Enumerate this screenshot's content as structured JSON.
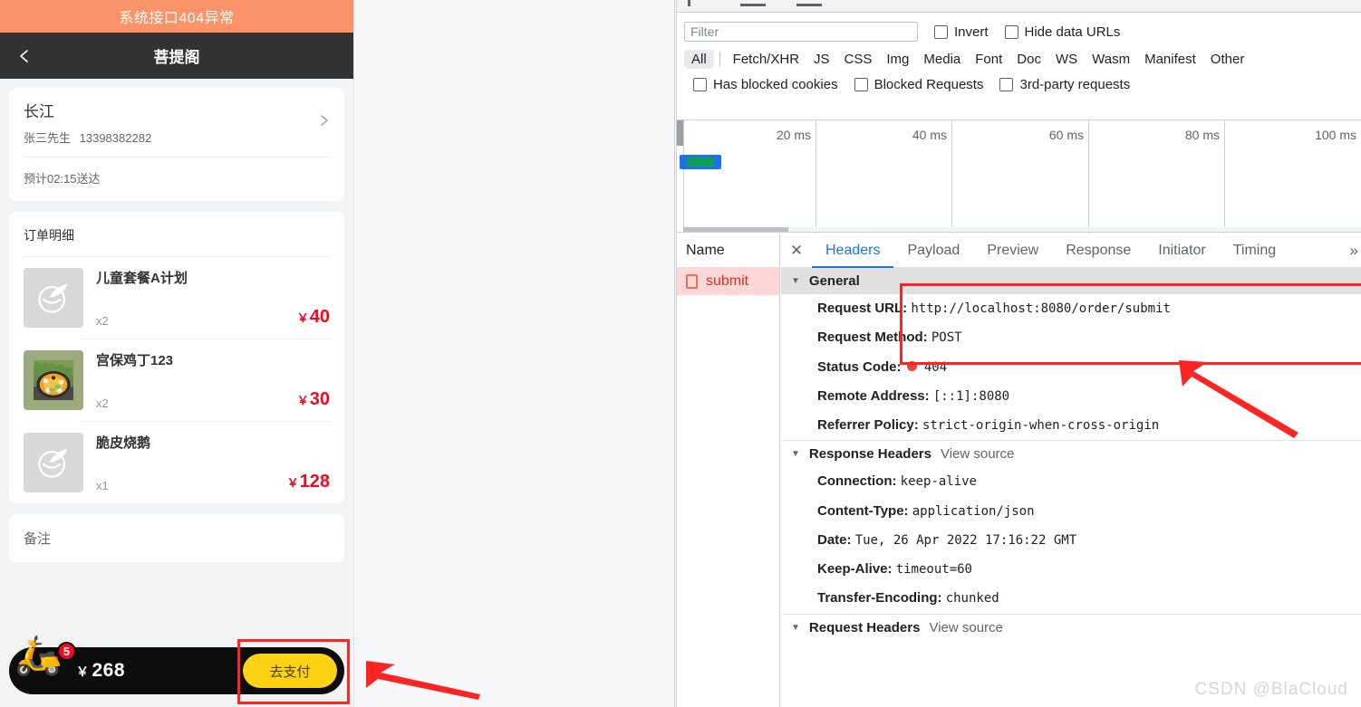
{
  "mobile": {
    "alert_banner": "系统接口404异常",
    "nav": {
      "back_icon": "chevron-left-icon",
      "title": "菩提阁"
    },
    "address": {
      "name": "长江",
      "contact": "张三先生",
      "phone": "13398382282",
      "chevron_icon": "chevron-right-icon",
      "eta": "预计02:15送达"
    },
    "order": {
      "title": "订单明细",
      "items": [
        {
          "name": "儿童套餐A计划",
          "qty": "x2",
          "currency": "￥",
          "price": "40",
          "thumb": "placeholder-bowl-icon"
        },
        {
          "name": "宫保鸡丁123",
          "qty": "x2",
          "currency": "￥",
          "price": "30",
          "thumb": "food-photo"
        },
        {
          "name": "脆皮烧鹅",
          "qty": "x1",
          "currency": "￥",
          "price": "128",
          "thumb": "placeholder-bowl-icon"
        }
      ]
    },
    "remark": {
      "label": "备注"
    },
    "submit_bar": {
      "rider_icon": "delivery-rider-icon",
      "cart_badge": "5",
      "currency": "￥",
      "total": "268",
      "pay_label": "去支付"
    }
  },
  "devtools": {
    "filter": {
      "placeholder": "Filter",
      "value": "",
      "invert_label": "Invert",
      "hide_data_urls_label": "Hide data URLs"
    },
    "type_filters": [
      "All",
      "Fetch/XHR",
      "JS",
      "CSS",
      "Img",
      "Media",
      "Font",
      "Doc",
      "WS",
      "Wasm",
      "Manifest",
      "Other"
    ],
    "type_active": "All",
    "blocked_filters": [
      "Has blocked cookies",
      "Blocked Requests",
      "3rd-party requests"
    ],
    "overview": {
      "ticks": [
        "20 ms",
        "40 ms",
        "60 ms",
        "80 ms",
        "100 ms"
      ],
      "bar_colors": {
        "waiting": "#1a73e8",
        "download": "#0f9d58"
      }
    },
    "requests": {
      "column_header": "Name",
      "rows": [
        {
          "name": "submit",
          "icon": "document-icon",
          "status": "error"
        }
      ]
    },
    "detail": {
      "close_icon": "close-icon",
      "tabs": [
        "Headers",
        "Payload",
        "Preview",
        "Response",
        "Initiator",
        "Timing"
      ],
      "active_tab": "Headers",
      "more_icon": "chevron-right-double-icon",
      "general": {
        "title": "General",
        "rows": [
          {
            "key": "Request URL:",
            "value": "http://localhost:8080/order/submit"
          },
          {
            "key": "Request Method:",
            "value": "POST"
          },
          {
            "key": "Status Code:",
            "value": "404",
            "dot": true
          },
          {
            "key": "Remote Address:",
            "value": "[::1]:8080"
          },
          {
            "key": "Referrer Policy:",
            "value": "strict-origin-when-cross-origin"
          }
        ]
      },
      "response_headers": {
        "title": "Response Headers",
        "view_source": "View source",
        "rows": [
          {
            "key": "Connection:",
            "value": "keep-alive"
          },
          {
            "key": "Content-Type:",
            "value": "application/json"
          },
          {
            "key": "Date:",
            "value": "Tue, 26 Apr 2022 17:16:22 GMT"
          },
          {
            "key": "Keep-Alive:",
            "value": "timeout=60"
          },
          {
            "key": "Transfer-Encoding:",
            "value": "chunked"
          }
        ]
      },
      "request_headers": {
        "title": "Request Headers",
        "view_source": "View source"
      }
    }
  },
  "annotations": {
    "highlight_color": "#fd2424",
    "watermark": "CSDN @BlaCloud"
  }
}
